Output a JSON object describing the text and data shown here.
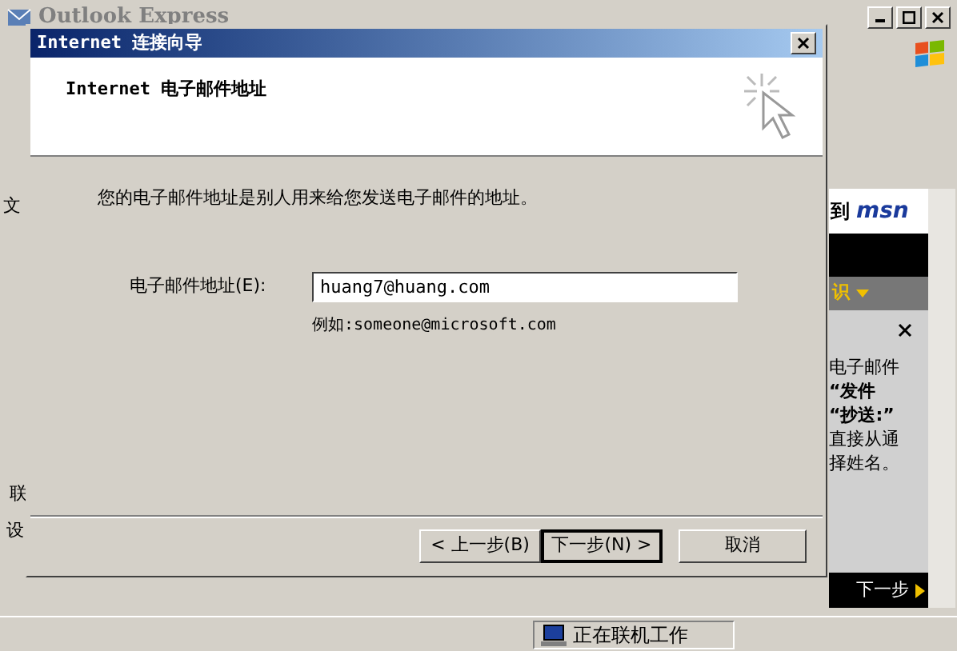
{
  "main_window": {
    "title": "Outlook Express",
    "left_fragments": [
      "文",
      "联",
      "设"
    ],
    "msn_panel": {
      "brand_left": "到",
      "brand": "msn",
      "band_text": "识",
      "pane_lines": [
        "电子邮件",
        "**“发件**",
        "**“抄送:”**",
        "直接从通",
        "择姓名。"
      ],
      "next": "下一步"
    },
    "status_bar": {
      "text": "正在联机工作"
    }
  },
  "dialog": {
    "title": "Internet 连接向导",
    "heading": "Internet 电子邮件地址",
    "intro": "您的电子邮件地址是别人用来给您发送电子邮件的地址。",
    "field": {
      "label": "电子邮件地址(E):",
      "value": "huang7@huang.com"
    },
    "example": "例如:someone@microsoft.com",
    "buttons": [
      {
        "label": "< 上一步(B)",
        "default": false
      },
      {
        "label": "下一步(N) >",
        "default": true
      },
      {
        "label": "取消",
        "default": false
      }
    ]
  }
}
